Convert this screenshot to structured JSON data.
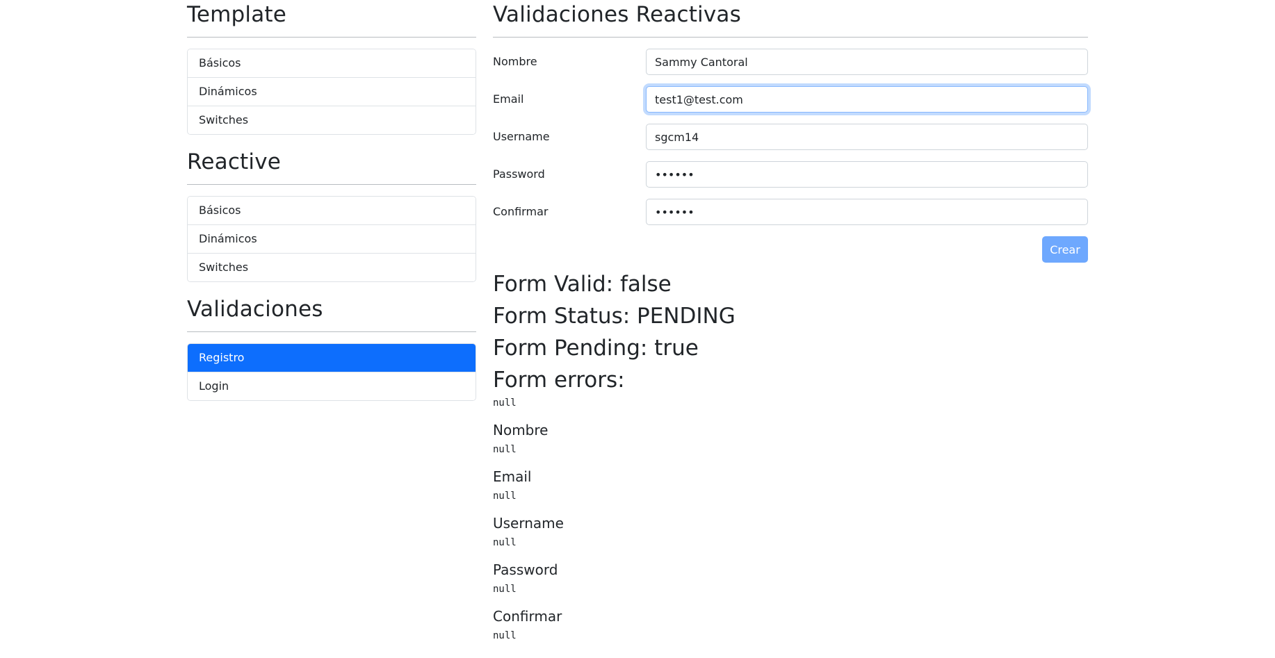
{
  "sidebar": {
    "sections": [
      {
        "title": "Template",
        "items": [
          {
            "label": "Básicos"
          },
          {
            "label": "Dinámicos"
          },
          {
            "label": "Switches"
          }
        ]
      },
      {
        "title": "Reactive",
        "items": [
          {
            "label": "Básicos"
          },
          {
            "label": "Dinámicos"
          },
          {
            "label": "Switches"
          }
        ]
      },
      {
        "title": "Validaciones",
        "items": [
          {
            "label": "Registro",
            "active": true
          },
          {
            "label": "Login"
          }
        ]
      }
    ]
  },
  "main": {
    "title": "Validaciones Reactivas",
    "fields": [
      {
        "label": "Nombre",
        "value": "Sammy Cantoral"
      },
      {
        "label": "Email",
        "value": "test1@test.com"
      },
      {
        "label": "Username",
        "value": "sgcm14"
      },
      {
        "label": "Password",
        "value": "••••••"
      },
      {
        "label": "Confirmar",
        "value": "••••••"
      }
    ],
    "submit_label": "Crear",
    "status": {
      "valid": "Form Valid: false",
      "status": "Form Status: PENDING",
      "pending": "Form Pending: true",
      "errors_title": "Form errors:",
      "errors_value": "null"
    },
    "field_errors": [
      {
        "name": "Nombre",
        "value": "null"
      },
      {
        "name": "Email",
        "value": "null"
      },
      {
        "name": "Username",
        "value": "null"
      },
      {
        "name": "Password",
        "value": "null"
      },
      {
        "name": "Confirmar",
        "value": "null"
      }
    ]
  },
  "colors": {
    "primary": "#0d6efd",
    "primary_disabled": "#6ea8fe",
    "focus": "#86b7fe"
  }
}
